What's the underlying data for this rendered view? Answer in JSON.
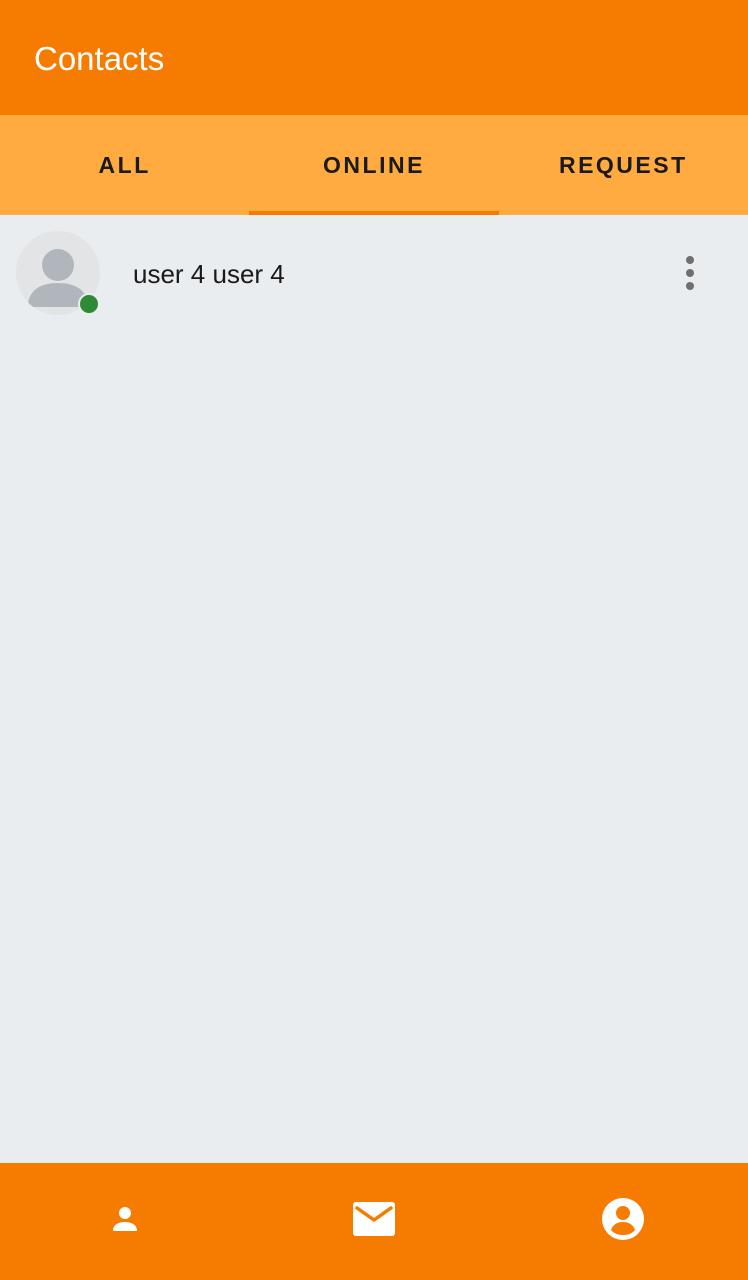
{
  "app_bar": {
    "title": "Contacts"
  },
  "tabs": [
    {
      "label": "ALL",
      "active": false
    },
    {
      "label": "ONLINE",
      "active": true
    },
    {
      "label": "REQUEST",
      "active": false
    }
  ],
  "contacts": [
    {
      "name": "user 4 user 4",
      "status": "online",
      "avatar_icon": "person-placeholder-icon",
      "menu_icon": "more-vert-icon"
    }
  ],
  "bottom_nav": [
    {
      "icon": "person-icon",
      "label": ""
    },
    {
      "icon": "mail-icon",
      "label": ""
    },
    {
      "icon": "account-circle-icon",
      "label": ""
    }
  ],
  "colors": {
    "primary": "#f57c00",
    "tab_background": "#ffab40",
    "content_background": "#e9edf0",
    "online_indicator": "#2e8b35"
  }
}
